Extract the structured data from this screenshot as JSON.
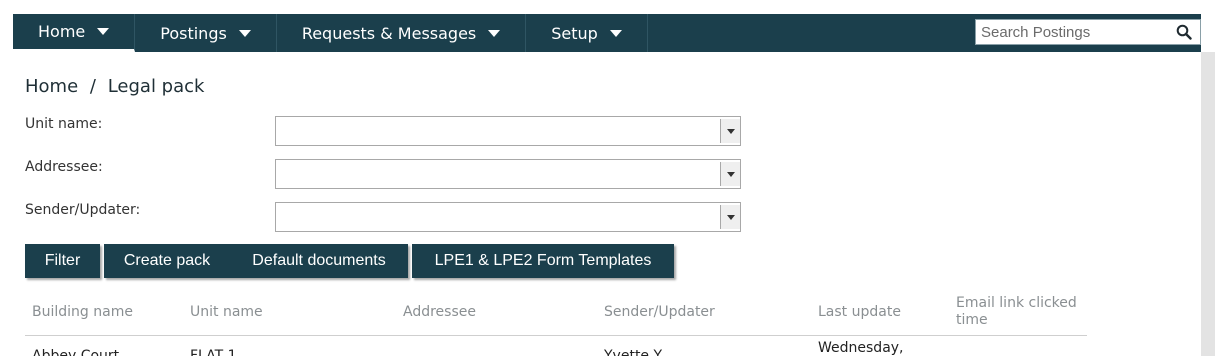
{
  "nav": {
    "items": [
      {
        "label": "Home"
      },
      {
        "label": "Postings"
      },
      {
        "label": "Requests & Messages"
      },
      {
        "label": "Setup"
      }
    ],
    "search_placeholder": "Search Postings"
  },
  "breadcrumb": {
    "home": "Home",
    "separator": "/",
    "current": "Legal pack"
  },
  "filters": {
    "unit_name_label": "Unit name:",
    "unit_name_value": "",
    "addressee_label": "Addressee:",
    "addressee_value": "",
    "sender_label": "Sender/Updater:",
    "sender_value": ""
  },
  "buttons": {
    "filter": "Filter",
    "create_pack": "Create pack",
    "default_documents": "Default documents",
    "lpe_templates": "LPE1 & LPE2 Form Templates"
  },
  "table": {
    "columns": [
      "Building name",
      "Unit name",
      "Addressee",
      "Sender/Updater",
      "Last update",
      "Email link clicked time"
    ],
    "first_row": {
      "building": "Abbey Court",
      "unit": "FLAT 1",
      "addressee": "",
      "sender": "Yvette Y",
      "last_update": "Wednesday,",
      "email_link": ""
    }
  },
  "colors": {
    "nav_bg": "#1b3f4c",
    "button_bg": "#1b3f4c",
    "header_text": "#8a8f92"
  }
}
